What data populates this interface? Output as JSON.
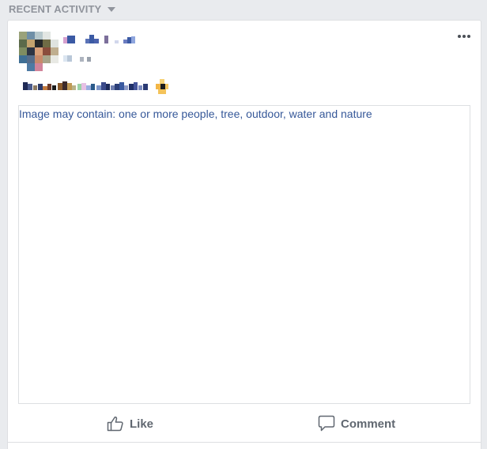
{
  "section": {
    "title": "RECENT ACTIVITY"
  },
  "post": {
    "image_alt": "Image may contain: one or more people, tree, outdoor, water and nature",
    "actions": {
      "like": "Like",
      "comment": "Comment"
    }
  },
  "colors": {
    "page_background": "#e9ebee",
    "card_background": "#ffffff",
    "link_blue": "#365899",
    "action_gray": "#606770",
    "header_gray": "#90949c"
  },
  "icons": {
    "section_toggle": "caret-down-icon",
    "post_menu": "more-options-icon",
    "like": "thumbs-up-icon",
    "comment": "speech-bubble-icon"
  }
}
